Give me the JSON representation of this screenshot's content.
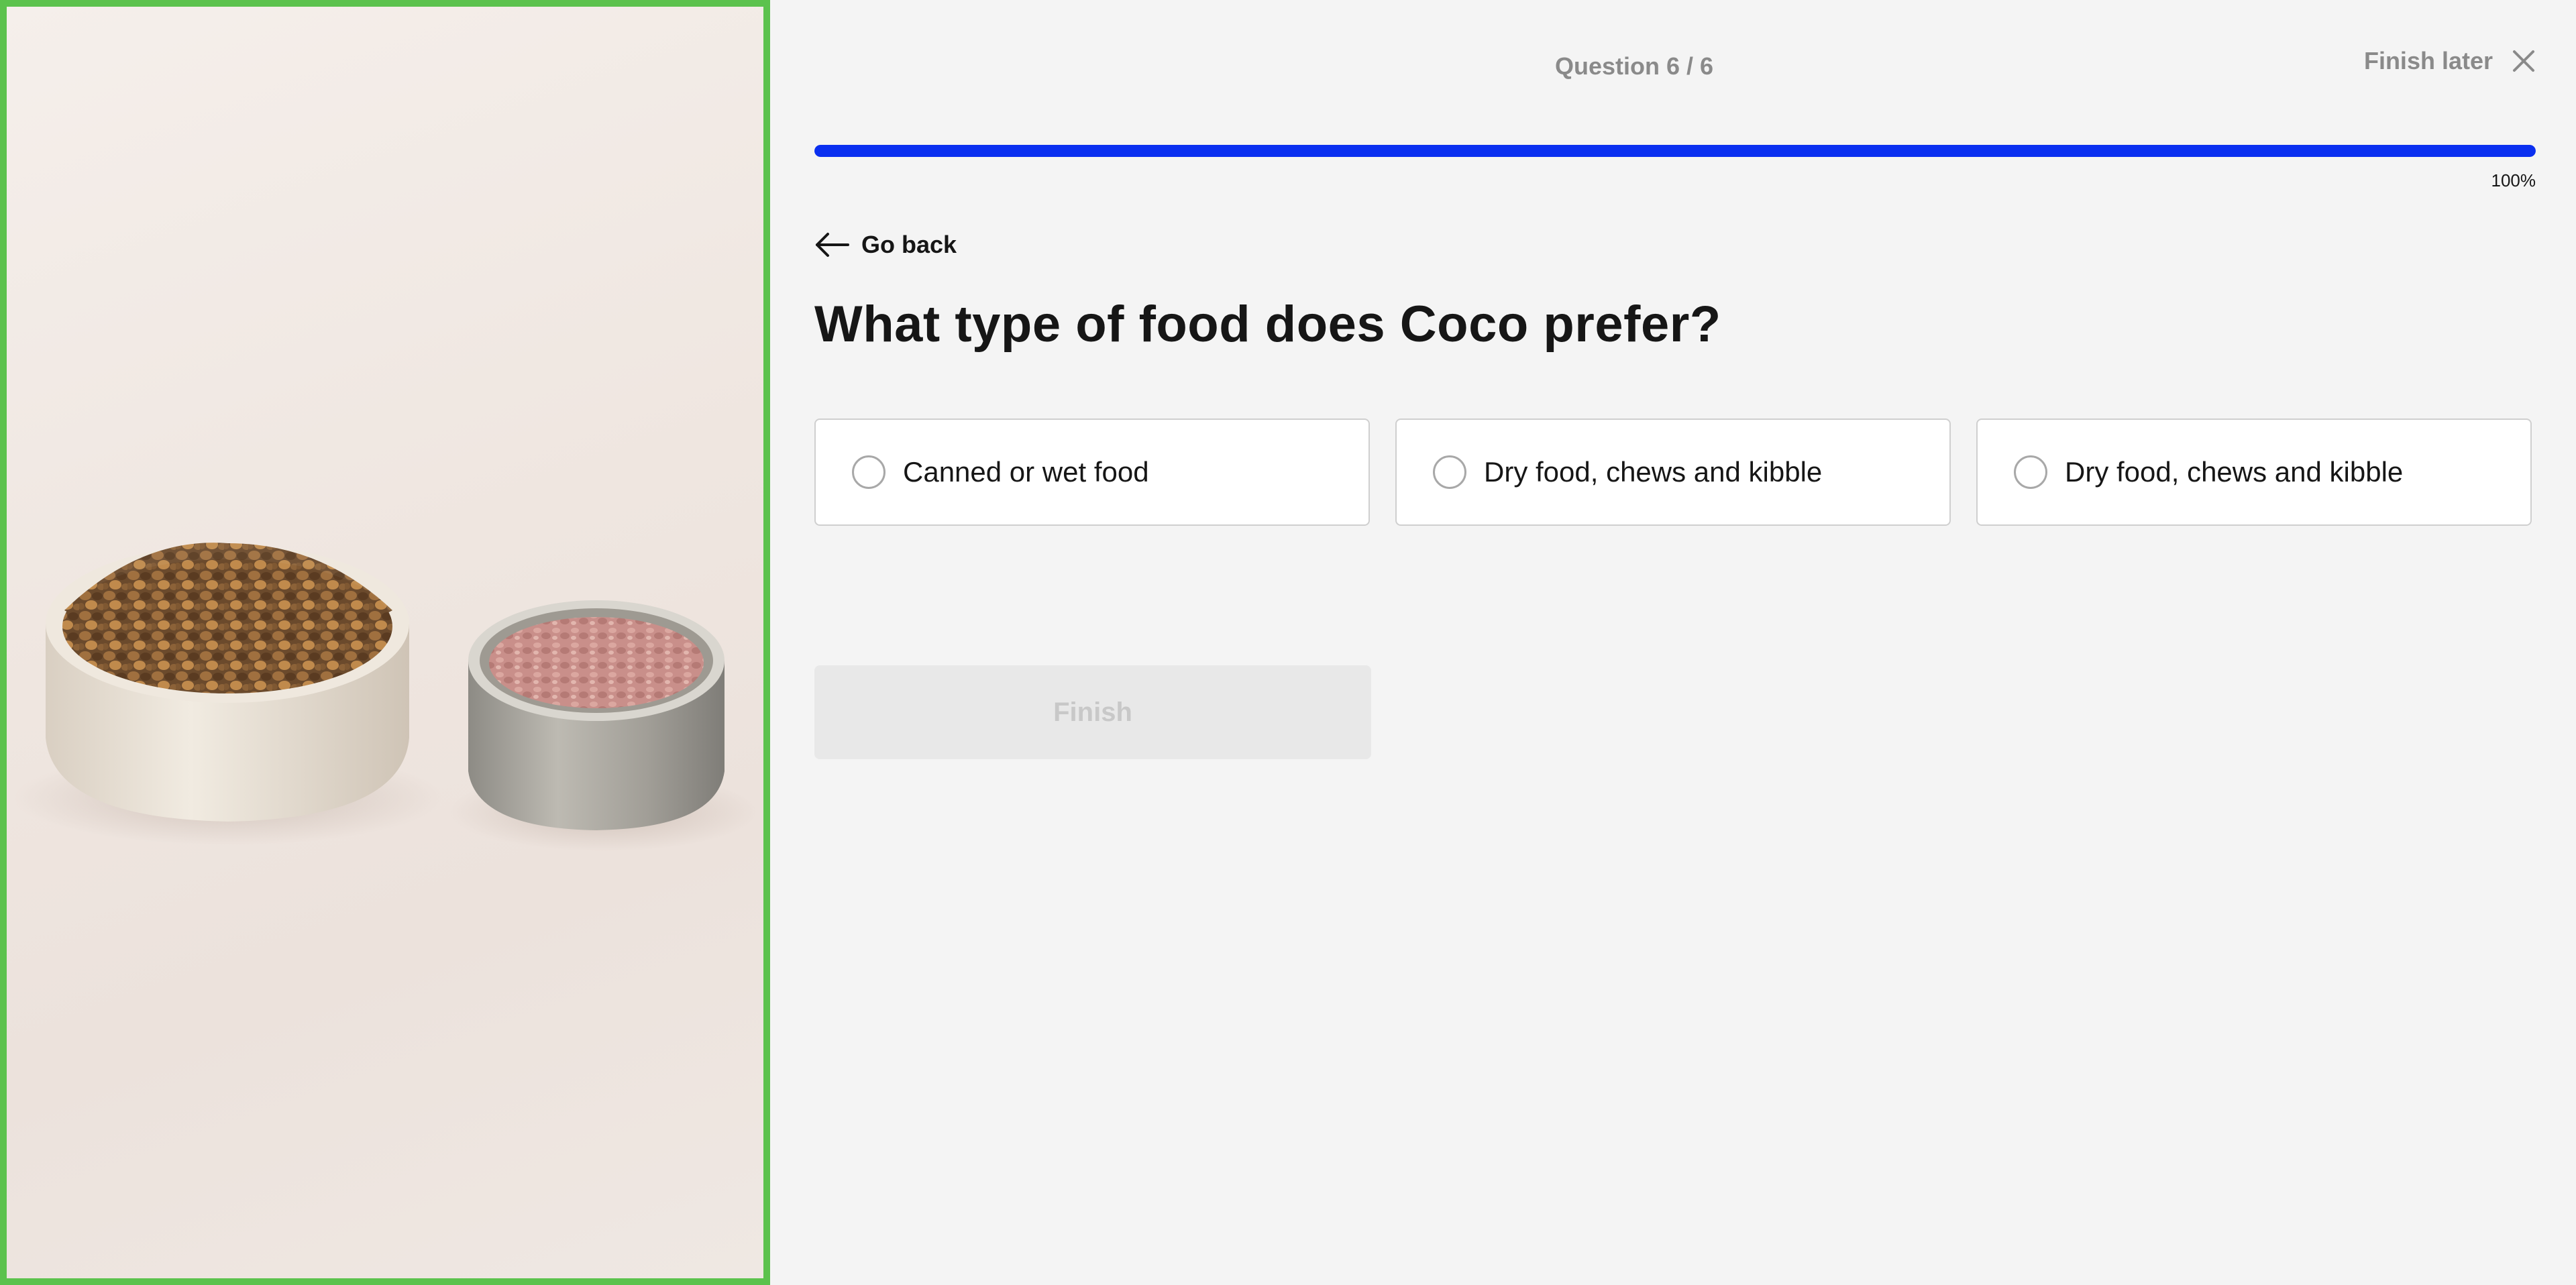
{
  "image_panel": {
    "border_color": "#5cc24d",
    "alt": "Bowl of dry kibble and an open can of wet food"
  },
  "header": {
    "progress_label": "Question 6 / 6",
    "finish_later_label": "Finish later",
    "close_icon": "close-icon"
  },
  "progress": {
    "value": 1.0,
    "percent_label": "100%",
    "color": "#0a2ff0"
  },
  "navigation": {
    "go_back_label": "Go back",
    "back_icon": "arrow-left-icon"
  },
  "question": {
    "title": "What type of food does Coco prefer?"
  },
  "options": [
    {
      "label": "Canned or wet food",
      "selected": false
    },
    {
      "label": "Dry food, chews and kibble",
      "selected": false
    },
    {
      "label": "Dry food, chews and kibble",
      "selected": false
    }
  ],
  "actions": {
    "finish_label": "Finish",
    "finish_disabled": true
  }
}
